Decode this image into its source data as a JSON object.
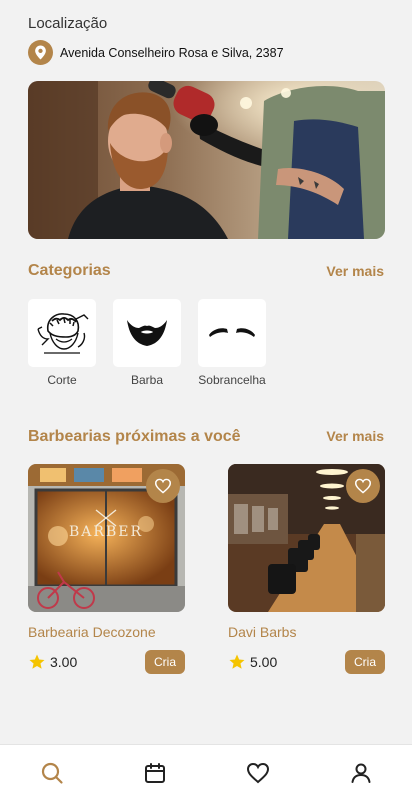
{
  "location": {
    "title": "Localização",
    "address": "Avenida Conselheiro Rosa e Silva, 2387",
    "icon": "location-pin-icon"
  },
  "hero": {
    "image": "barber-cutting-hair-photo"
  },
  "categories": {
    "title": "Categorias",
    "see_more": "Ver mais",
    "items": [
      {
        "label": "Corte",
        "icon": "haircut-icon"
      },
      {
        "label": "Barba",
        "icon": "beard-icon"
      },
      {
        "label": "Sobrancelha",
        "icon": "eyebrow-icon"
      }
    ]
  },
  "nearby": {
    "title": "Barbearias próximas a você",
    "see_more": "Ver mais",
    "shops": [
      {
        "name": "Barbearia Decozone",
        "rating": "3.00",
        "tag": "Cria",
        "image_sign": "BARBER"
      },
      {
        "name": "Davi Barbs",
        "rating": "5.00",
        "tag": "Cria"
      }
    ]
  },
  "bottom_nav": {
    "items": [
      {
        "icon": "search-icon",
        "active": true
      },
      {
        "icon": "calendar-icon",
        "active": false
      },
      {
        "icon": "heart-icon",
        "active": false
      },
      {
        "icon": "profile-icon",
        "active": false
      }
    ]
  },
  "colors": {
    "accent": "#b3854a",
    "background": "#f2f2f2",
    "star": "#f5c400"
  }
}
